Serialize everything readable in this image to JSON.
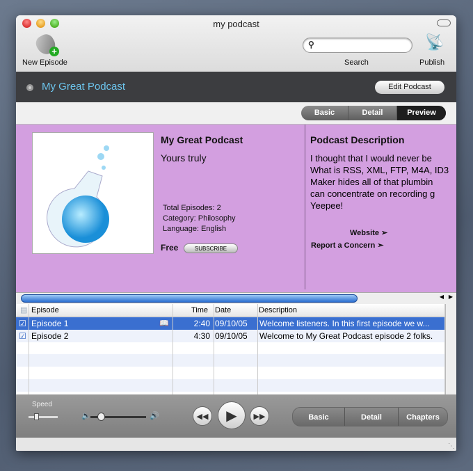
{
  "window": {
    "title": "my podcast"
  },
  "toolbar": {
    "new_episode": "New Episode",
    "search_label": "Search",
    "search_placeholder": "",
    "publish": "Publish"
  },
  "header": {
    "podcast_name": "My Great Podcast",
    "edit_button": "Edit Podcast"
  },
  "view_tabs": [
    {
      "label": "Basic",
      "active": false
    },
    {
      "label": "Detail",
      "active": false
    },
    {
      "label": "Preview",
      "active": true
    }
  ],
  "preview": {
    "title": "My Great Podcast",
    "author": "Yours truly",
    "total_episodes": "Total Episodes: 2",
    "category": "Category: Philosophy",
    "language": "Language: English",
    "price": "Free",
    "subscribe": "SUBSCRIBE",
    "description_heading": "Podcast Description",
    "description_lines": [
      "I thought that I would never be",
      "What is RSS, XML, FTP, M4A, ID3",
      "Maker hides all of that plumbin",
      "can concentrate on recording g",
      "Yeepee!"
    ],
    "website": "Website",
    "report": "Report a Concern"
  },
  "table": {
    "columns": [
      "Episode",
      "Time",
      "Date",
      "Description"
    ],
    "rows": [
      {
        "checked": true,
        "selected": true,
        "episode": "Episode 1",
        "time": "2:40",
        "date": "09/10/05",
        "description": "Welcome listeners. In this first episode we w..."
      },
      {
        "checked": true,
        "selected": false,
        "episode": "Episode 2",
        "time": "4:30",
        "date": "09/10/05",
        "description": "Welcome to My Great Podcast episode 2 folks."
      }
    ]
  },
  "controls": {
    "speed_label": "Speed",
    "volume_level": 0.15,
    "segments": [
      "Basic",
      "Detail",
      "Chapters"
    ]
  },
  "colors": {
    "accent": "#3a6fd0",
    "preview_bg": "#d39fe0",
    "header_text": "#6cc4ec"
  }
}
